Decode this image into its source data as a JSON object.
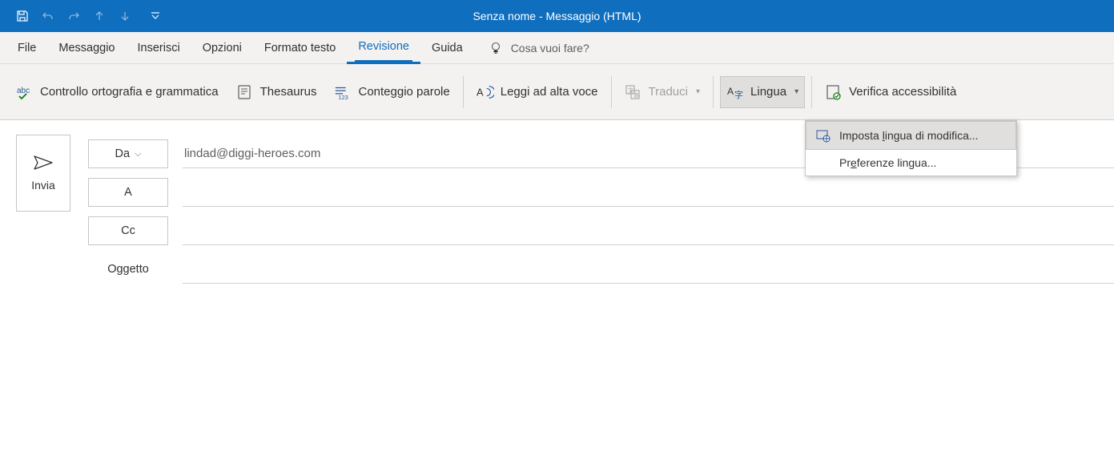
{
  "title": "Senza nome  -  Messaggio (HTML)",
  "menubar": {
    "file": "File",
    "messaggio": "Messaggio",
    "inserisci": "Inserisci",
    "opzioni": "Opzioni",
    "formato": "Formato testo",
    "revisione": "Revisione",
    "guida": "Guida",
    "tellme": "Cosa vuoi fare?"
  },
  "ribbon": {
    "spellcheck": "Controllo ortografia e grammatica",
    "thesaurus": "Thesaurus",
    "wordcount": "Conteggio parole",
    "readaloud": "Leggi ad alta voce",
    "translate": "Traduci",
    "language": "Lingua",
    "accessibility": "Verifica accessibilità"
  },
  "dropdown": {
    "set_lang": "Imposta lingua di modifica...",
    "set_lang_pre": "Imposta ",
    "set_lang_u": "l",
    "set_lang_post": "ingua di modifica...",
    "prefs_pre": "Pr",
    "prefs_u": "e",
    "prefs_post": "ferenze lingua..."
  },
  "compose": {
    "send": "Invia",
    "from_label": "Da",
    "from_value": "lindad@diggi-heroes.com",
    "to_label": "A",
    "cc_label": "Cc",
    "subject_label": "Oggetto"
  }
}
